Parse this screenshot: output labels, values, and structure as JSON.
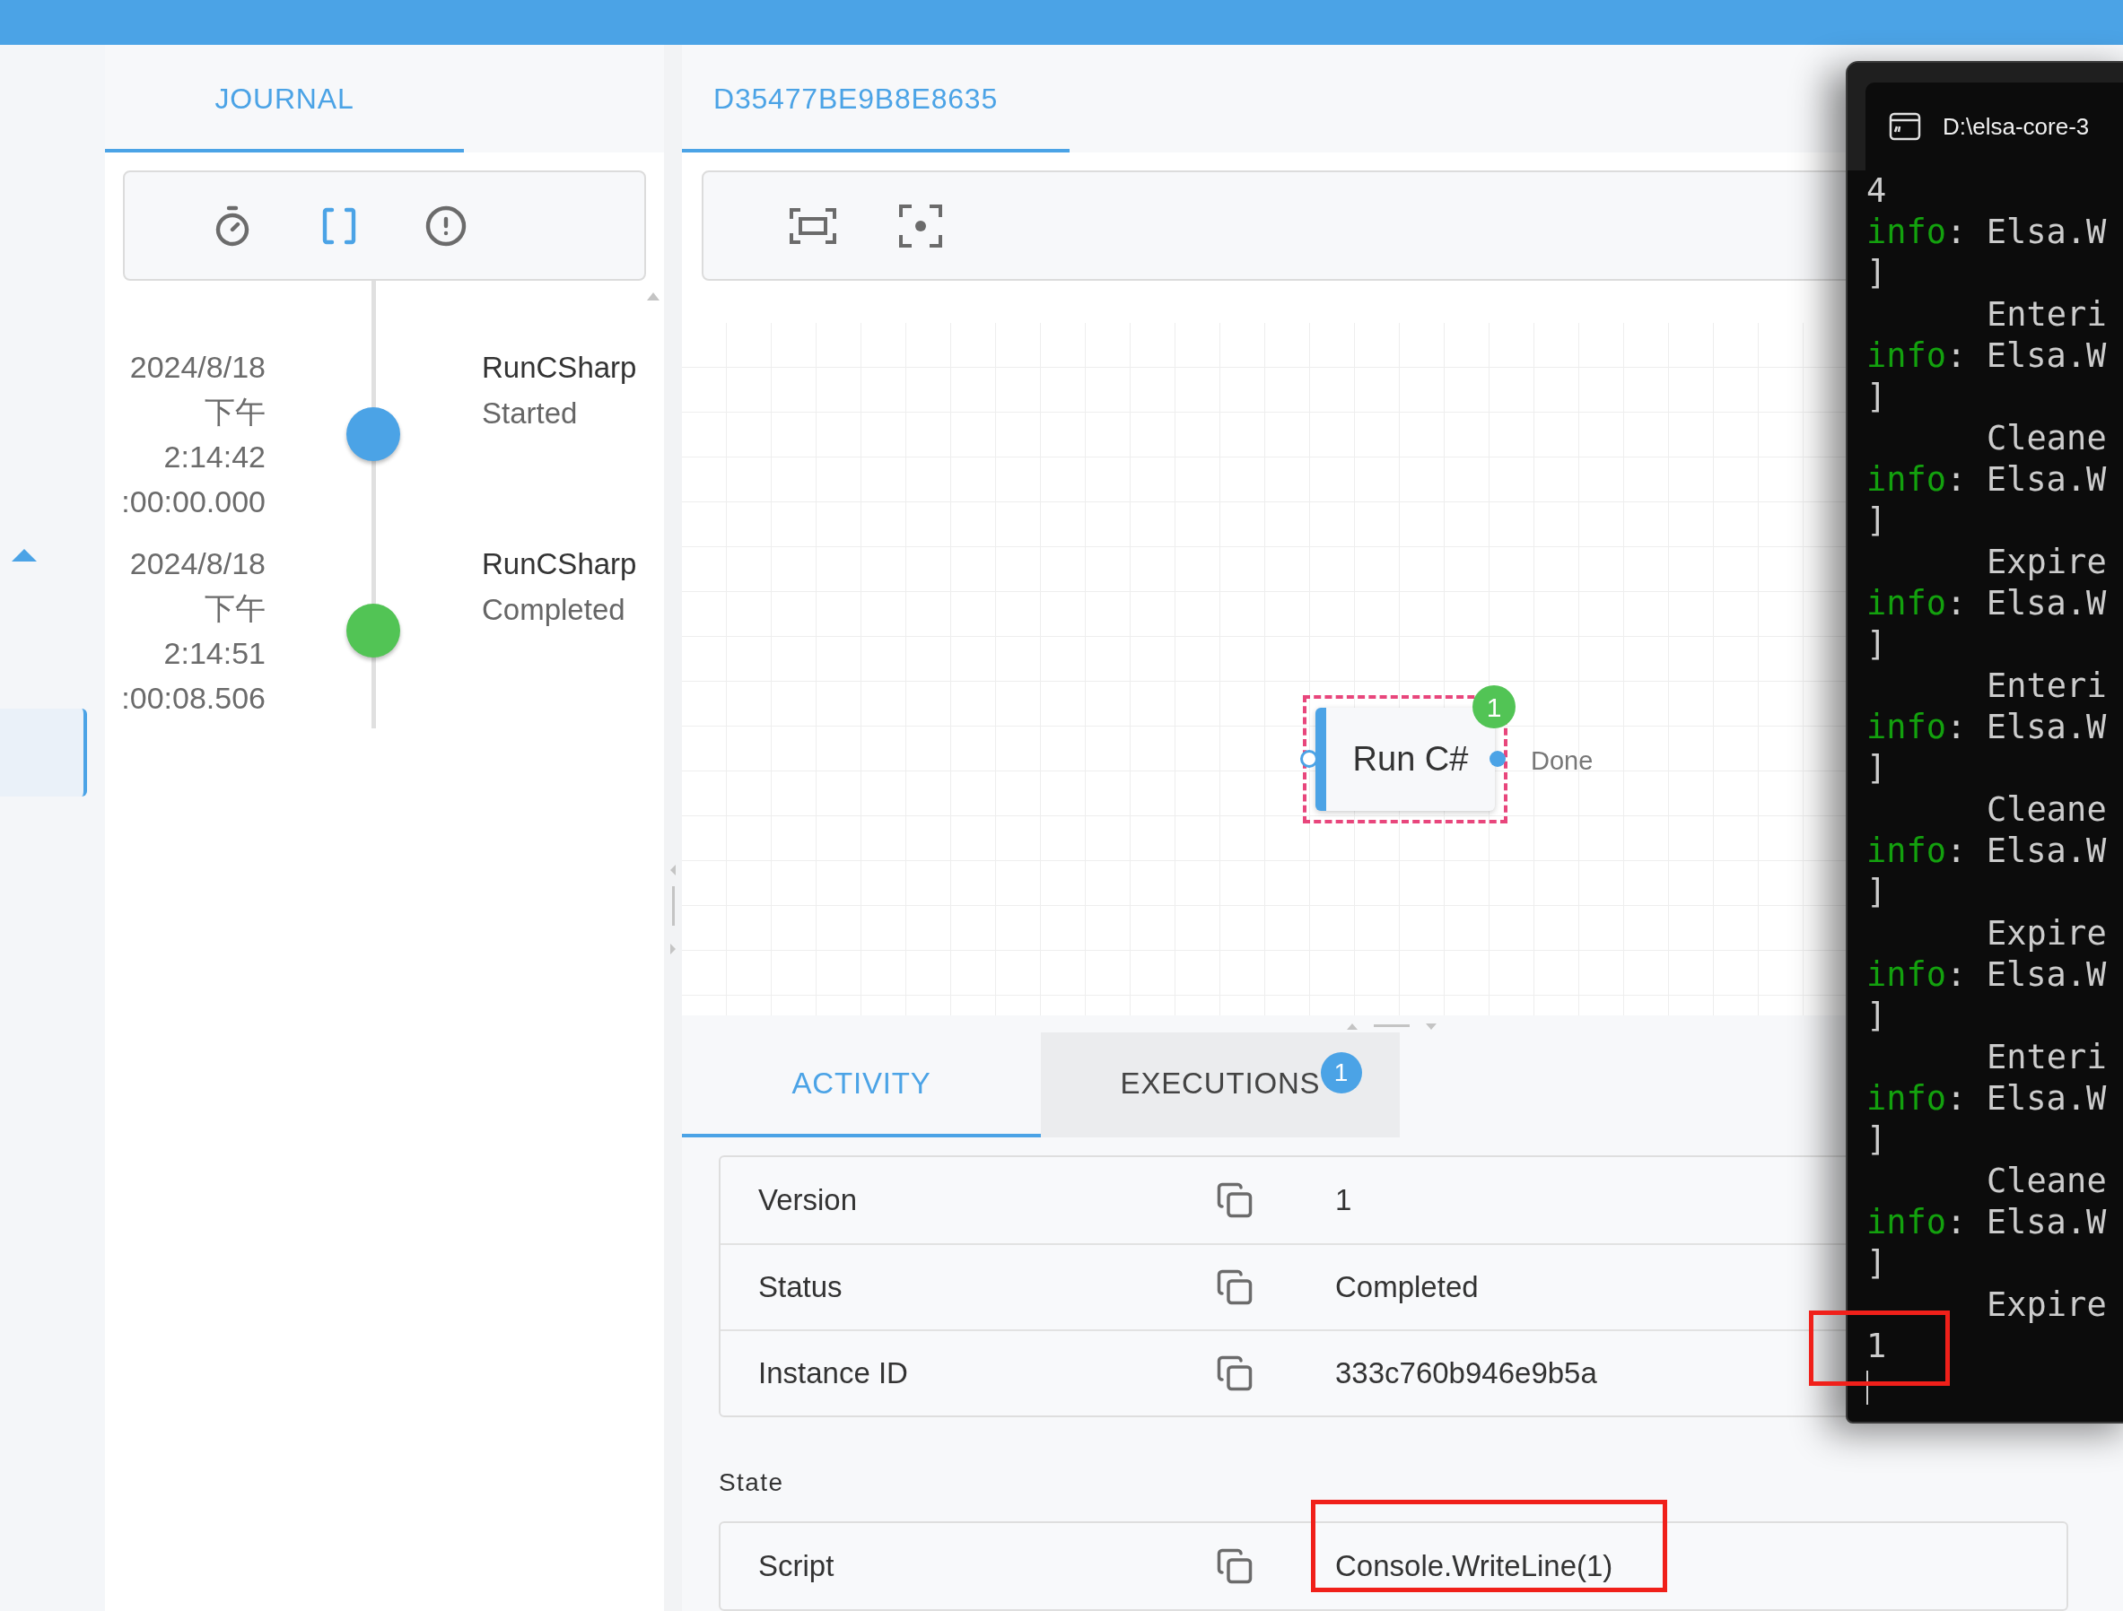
{
  "sidebar": {
    "items": [
      {
        "selected": true
      }
    ]
  },
  "journal_tab": {
    "label": "JOURNAL",
    "selected": true
  },
  "journal_toolbar": [
    {
      "kind": "timer",
      "selected": false
    },
    {
      "kind": "brackets",
      "selected": true
    },
    {
      "kind": "alert",
      "selected": false
    }
  ],
  "journal_entries": [
    {
      "date": "2024/8/18",
      "period": "下午",
      "time": "2:14:42",
      "elapsed": ":00:00.000",
      "activity": "RunCSharp",
      "event": "Started",
      "color": "#4ba3e6"
    },
    {
      "date": "2024/8/18",
      "period": "下午",
      "time": "2:14:51",
      "elapsed": ":00:08.506",
      "activity": "RunCSharp",
      "event": "Completed",
      "color": "#52c455"
    }
  ],
  "instance_tab": {
    "label": "D35477BE9B8E8635",
    "selected": true
  },
  "designer_toolbar": [
    {
      "kind": "fit"
    },
    {
      "kind": "center"
    }
  ],
  "node": {
    "title": "Run C#",
    "outcome": "Done",
    "execution_count": "1",
    "selected": true
  },
  "bottom_tabs": [
    {
      "label": "ACTIVITY",
      "selected": true
    },
    {
      "label": "EXECUTIONS",
      "selected": false,
      "badge": "1"
    }
  ],
  "properties": [
    {
      "label": "Version",
      "value": "1"
    },
    {
      "label": "Status",
      "value": "Completed"
    },
    {
      "label": "Instance ID",
      "value": "333c760b946e9b5a"
    }
  ],
  "state": {
    "title": "State",
    "rows": [
      {
        "label": "Script",
        "value": "Console.WriteLine(1)"
      }
    ]
  },
  "terminal": {
    "title": "D:\\elsa-core-3",
    "lines": [
      {
        "kind": "plain",
        "text": "4"
      },
      {
        "kind": "log",
        "level": "info",
        "text": ": Elsa.W"
      },
      {
        "kind": "plain",
        "text": "]"
      },
      {
        "kind": "detail",
        "text": "Enteri"
      },
      {
        "kind": "log",
        "level": "info",
        "text": ": Elsa.W"
      },
      {
        "kind": "plain",
        "text": "]"
      },
      {
        "kind": "detail",
        "text": "Cleane"
      },
      {
        "kind": "log",
        "level": "info",
        "text": ": Elsa.W"
      },
      {
        "kind": "plain",
        "text": "]"
      },
      {
        "kind": "detail",
        "text": "Expire"
      },
      {
        "kind": "log",
        "level": "info",
        "text": ": Elsa.W"
      },
      {
        "kind": "plain",
        "text": "]"
      },
      {
        "kind": "detail",
        "text": "Enteri"
      },
      {
        "kind": "log",
        "level": "info",
        "text": ": Elsa.W"
      },
      {
        "kind": "plain",
        "text": "]"
      },
      {
        "kind": "detail",
        "text": "Cleane"
      },
      {
        "kind": "log",
        "level": "info",
        "text": ": Elsa.W"
      },
      {
        "kind": "plain",
        "text": "]"
      },
      {
        "kind": "detail",
        "text": "Expire"
      },
      {
        "kind": "log",
        "level": "info",
        "text": ": Elsa.W"
      },
      {
        "kind": "plain",
        "text": "]"
      },
      {
        "kind": "detail",
        "text": "Enteri"
      },
      {
        "kind": "log",
        "level": "info",
        "text": ": Elsa.W"
      },
      {
        "kind": "plain",
        "text": "]"
      },
      {
        "kind": "detail",
        "text": "Cleane"
      },
      {
        "kind": "log",
        "level": "info",
        "text": ": Elsa.W"
      },
      {
        "kind": "plain",
        "text": "]"
      },
      {
        "kind": "detail",
        "text": "Expire"
      },
      {
        "kind": "plain",
        "text": "1"
      }
    ]
  }
}
